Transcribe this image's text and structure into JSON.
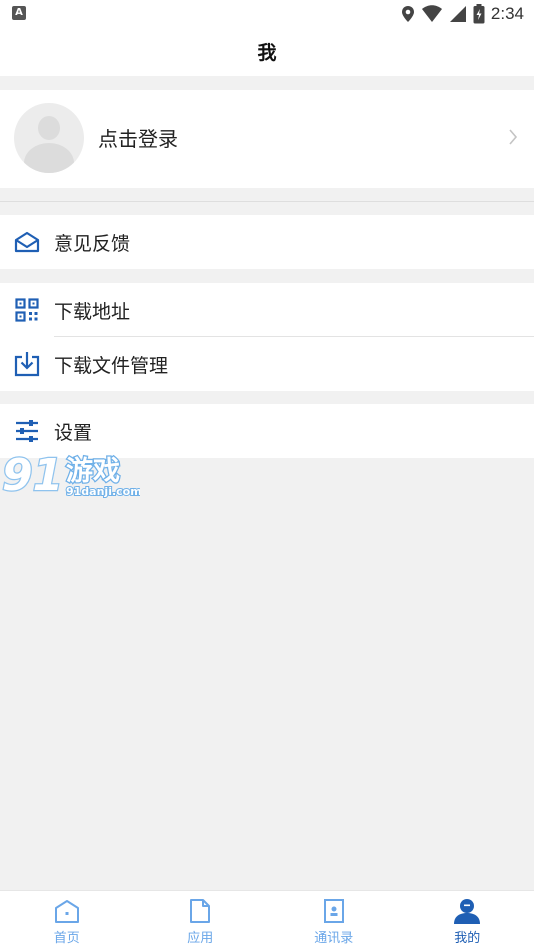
{
  "status_bar": {
    "left_badge": "A",
    "time": "2:34"
  },
  "header": {
    "title": "我"
  },
  "profile": {
    "login_label": "点击登录"
  },
  "menu": {
    "feedback": {
      "label": "意见反馈",
      "icon": "mail-open-icon"
    },
    "download_address": {
      "label": "下载地址",
      "icon": "qr-code-icon"
    },
    "download_manager": {
      "label": "下载文件管理",
      "icon": "download-box-icon"
    },
    "settings": {
      "label": "设置",
      "icon": "sliders-icon"
    }
  },
  "watermark": {
    "brand": "游戏",
    "number": "91",
    "url": "91danji.com"
  },
  "tabs": [
    {
      "label": "首页",
      "icon": "home-icon",
      "active": false
    },
    {
      "label": "应用",
      "icon": "file-icon",
      "active": false
    },
    {
      "label": "通讯录",
      "icon": "contacts-icon",
      "active": false
    },
    {
      "label": "我的",
      "icon": "person-icon",
      "active": true
    }
  ],
  "colors": {
    "accent": "#1f5fb4",
    "tab_inactive": "#6aa6e8",
    "background": "#f1f1f1"
  }
}
